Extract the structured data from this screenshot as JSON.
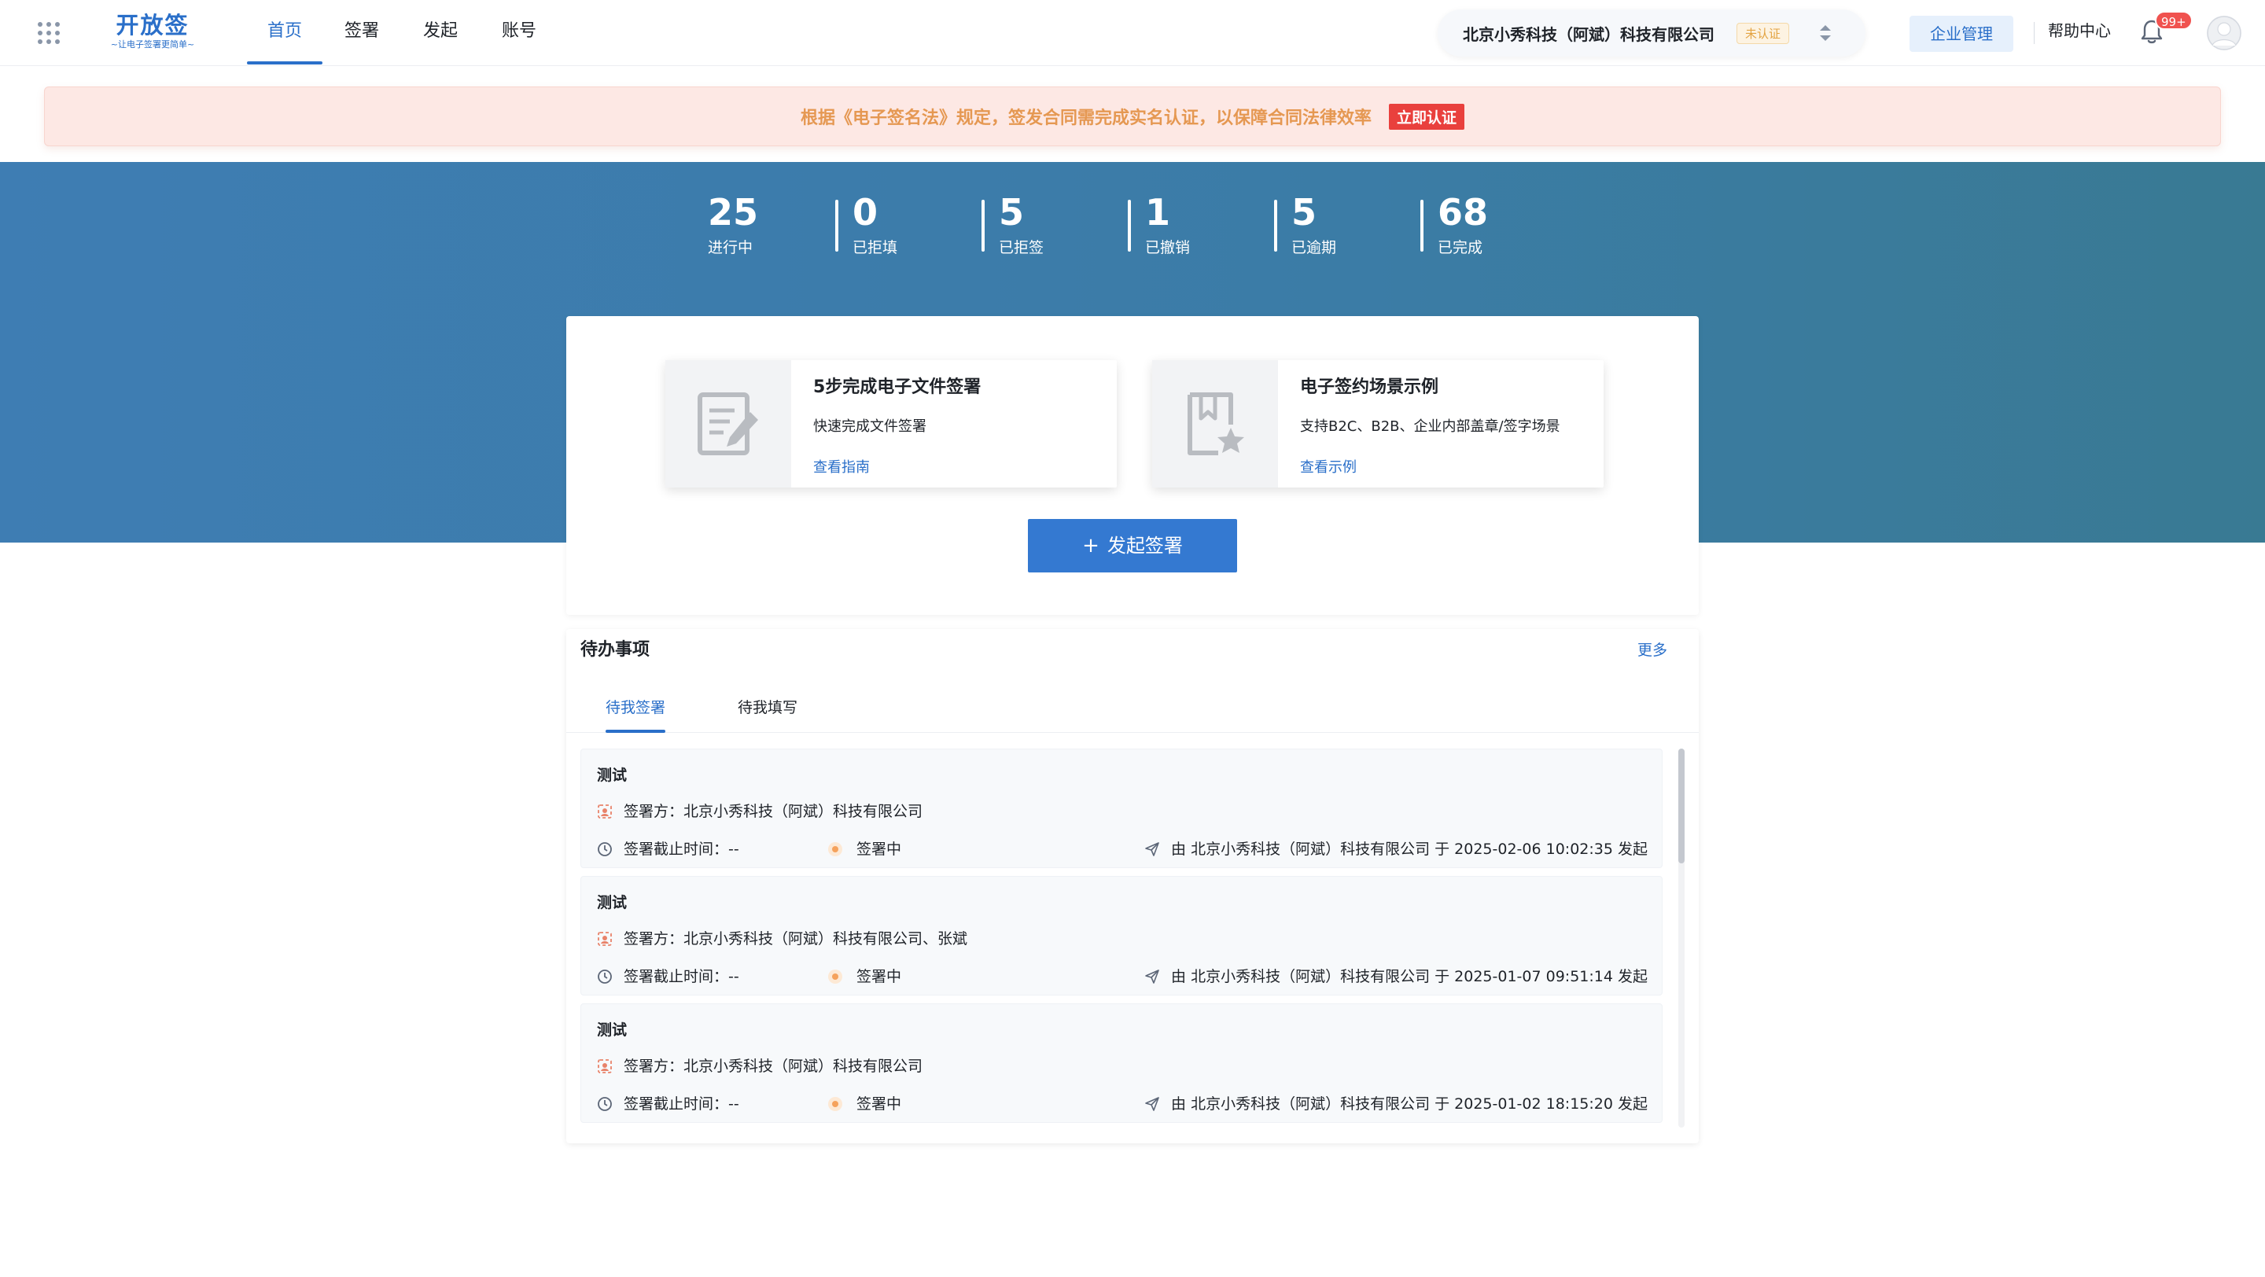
{
  "logo": {
    "title": "开放签",
    "subtitle": "~让电子签署更简单~"
  },
  "nav": {
    "items": [
      "首页",
      "签署",
      "发起",
      "账号"
    ],
    "active_index": 0
  },
  "header": {
    "company_name": "北京小秀科技（阿斌）科技有限公司",
    "company_badge": "未认证",
    "enterprise_button": "企业管理",
    "help_link": "帮助中心",
    "notification_count": "99+"
  },
  "alert": {
    "text": "根据《电子签名法》规定，签发合同需完成实名认证，以保障合同法律效率",
    "button": "立即认证"
  },
  "stats": [
    {
      "value": "25",
      "label": "进行中"
    },
    {
      "value": "0",
      "label": "已拒填"
    },
    {
      "value": "5",
      "label": "已拒签"
    },
    {
      "value": "1",
      "label": "已撤销"
    },
    {
      "value": "5",
      "label": "已逾期"
    },
    {
      "value": "68",
      "label": "已完成"
    }
  ],
  "guides": [
    {
      "title": "5步完成电子文件签署",
      "desc": "快速完成文件签署",
      "link": "查看指南",
      "icon": "document-edit-icon"
    },
    {
      "title": "电子签约场景示例",
      "desc": "支持B2C、B2B、企业内部盖章/签字场景",
      "link": "查看示例",
      "icon": "bookmark-star-icon"
    }
  ],
  "start_button": "发起签署",
  "todo": {
    "title": "待办事项",
    "more": "更多",
    "tabs": [
      "待我签署",
      "待我填写"
    ],
    "items": [
      {
        "title": "测试",
        "signers": "签署方：北京小秀科技（阿斌）科技有限公司",
        "deadline": "签署截止时间：--",
        "status": "签署中",
        "initiator": "由 北京小秀科技（阿斌）科技有限公司 于 2025-02-06 10:02:35 发起"
      },
      {
        "title": "测试",
        "signers": "签署方：北京小秀科技（阿斌）科技有限公司、张斌",
        "deadline": "签署截止时间：--",
        "status": "签署中",
        "initiator": "由 北京小秀科技（阿斌）科技有限公司 于 2025-01-07 09:51:14 发起"
      },
      {
        "title": "测试",
        "signers": "签署方：北京小秀科技（阿斌）科技有限公司",
        "deadline": "签署截止时间：--",
        "status": "签署中",
        "initiator": "由 北京小秀科技（阿斌）科技有限公司 于 2025-01-02 18:15:20 发起"
      }
    ]
  },
  "colors": {
    "brand": "#2a6fc9",
    "banner_from": "#3e7db3",
    "banner_to": "#397a93",
    "alert_bg": "#fde8e4",
    "alert_text": "#e59852",
    "danger": "#e9403d",
    "status_dot": "#f5a25c"
  }
}
